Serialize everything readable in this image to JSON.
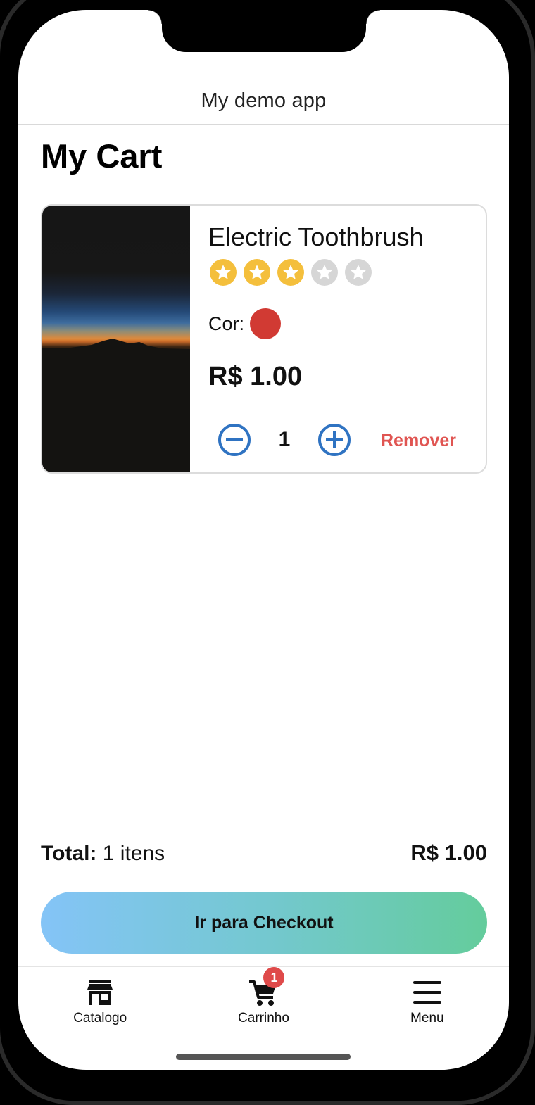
{
  "app": {
    "title": "My demo app"
  },
  "page": {
    "title": "My Cart"
  },
  "cart_item": {
    "name": "Electric Toothbrush",
    "rating": 3,
    "rating_max": 5,
    "color_label": "Cor:",
    "color_value": "#d13a33",
    "price": "R$ 1.00",
    "quantity": "1",
    "remove_label": "Remover"
  },
  "summary": {
    "total_label": "Total:",
    "total_count": "1 itens",
    "total_amount": "R$ 1.00"
  },
  "checkout": {
    "label": "Ir para Checkout"
  },
  "tabs": [
    {
      "label": "Catalogo",
      "icon": "store-icon"
    },
    {
      "label": "Carrinho",
      "icon": "cart-icon",
      "badge": "1"
    },
    {
      "label": "Menu",
      "icon": "menu-icon"
    }
  ],
  "colors": {
    "accent_blue": "#2f73c2",
    "remove_red": "#e05552",
    "star_filled": "#f4bf3c",
    "star_empty": "#d6d6d6",
    "badge_red": "#df4a4a",
    "checkout_gradient_start": "#84c4f7",
    "checkout_gradient_end": "#64cc9c"
  }
}
